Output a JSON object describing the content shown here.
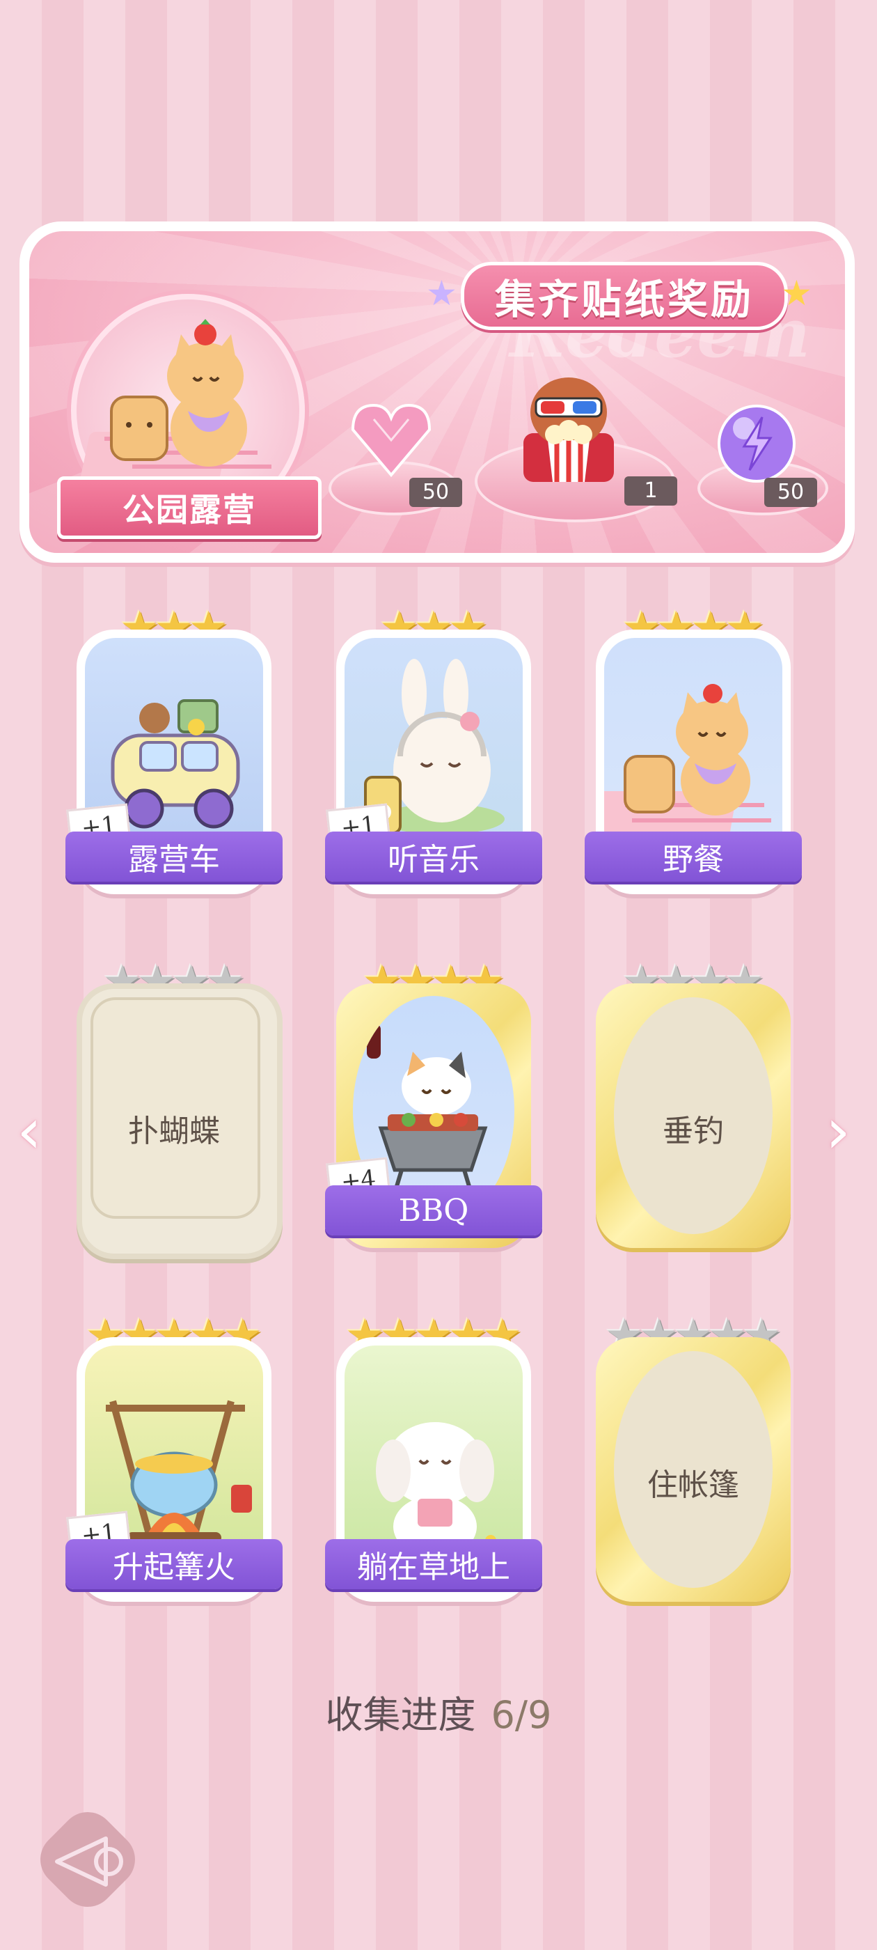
{
  "banner": {
    "title": "集齐贴纸奖励",
    "watermark": "Redeem",
    "location_label": "公园露营",
    "rewards": [
      {
        "name": "pink-diamond-icon",
        "count": "50"
      },
      {
        "name": "popcorn-bear-icon",
        "count": "1"
      },
      {
        "name": "energy-orb-icon",
        "count": "50"
      }
    ]
  },
  "cards": [
    {
      "label": "露营车",
      "stars": 3,
      "filled": 3,
      "plus": "+1",
      "collected": true
    },
    {
      "label": "听音乐",
      "stars": 3,
      "filled": 3,
      "plus": "+1",
      "collected": true
    },
    {
      "label": "野餐",
      "stars": 4,
      "filled": 4,
      "plus": "",
      "collected": true
    },
    {
      "label": "扑蝴蝶",
      "stars": 4,
      "filled": 0,
      "plus": "",
      "collected": false
    },
    {
      "label": "BBQ",
      "stars": 4,
      "filled": 4,
      "plus": "+4",
      "collected": true
    },
    {
      "label": "垂钓",
      "stars": 4,
      "filled": 0,
      "plus": "",
      "collected": false
    },
    {
      "label": "升起篝火",
      "stars": 5,
      "filled": 5,
      "plus": "+1",
      "collected": true
    },
    {
      "label": "躺在草地上",
      "stars": 5,
      "filled": 5,
      "plus": "",
      "collected": true
    },
    {
      "label": "住帐篷",
      "stars": 5,
      "filled": 0,
      "plus": "",
      "collected": false
    }
  ],
  "progress": {
    "label": "收集进度",
    "value": "6/9"
  },
  "colors": {
    "gold_star": "#f4c542",
    "grey_star": "#c4c4c4",
    "label_purple": "#8f5fe0",
    "pink_bg": "#f6d6df"
  }
}
